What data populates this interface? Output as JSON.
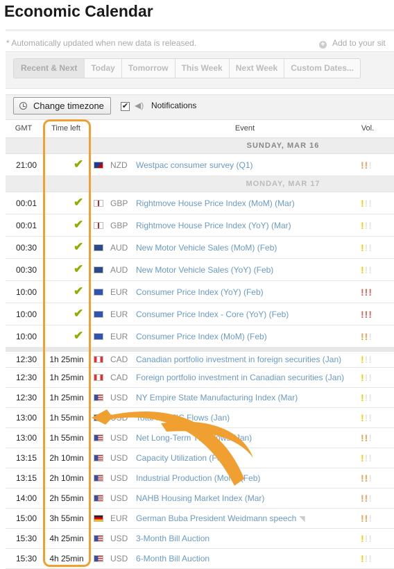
{
  "title": "Economic Calendar",
  "auto_note": "* Automatically updated when new data is released.",
  "add_site": "Add to your sit",
  "tabs": [
    "Recent & Next",
    "Today",
    "Tomorrow",
    "This Week",
    "Next Week",
    "Custom Dates..."
  ],
  "toolbar": {
    "timezone_button": "Change timezone",
    "notifications_label": "Notifications",
    "notifications_checked": true
  },
  "columns": {
    "gmt": "GMT",
    "time_left": "Time left",
    "event": "Event",
    "vol": "Vol."
  },
  "colors": {
    "accent_highlight": "#f0a030",
    "event_link": "#6a9ac8",
    "check_green": "#8cb000"
  },
  "days": [
    {
      "label": "SUNDAY, MAR 16",
      "rows": [
        {
          "gmt": "21:00",
          "done": true,
          "currency": "NZD",
          "flag": "nz-flag-icon",
          "event": "Westpac consumer survey (Q1)",
          "vol": 2
        }
      ]
    },
    {
      "label": "MONDAY, MAR 17",
      "rows": [
        {
          "gmt": "00:01",
          "done": true,
          "currency": "GBP",
          "flag": "gb-flag-icon",
          "event": "Rightmove House Price Index (MoM) (Mar)",
          "vol": 1
        },
        {
          "gmt": "00:01",
          "done": true,
          "currency": "GBP",
          "flag": "gb-flag-icon",
          "event": "Rightmove House Price Index (YoY) (Mar)",
          "vol": 1
        },
        {
          "gmt": "00:30",
          "done": true,
          "currency": "AUD",
          "flag": "au-flag-icon",
          "event": "New Motor Vehicle Sales (MoM) (Feb)",
          "vol": 1
        },
        {
          "gmt": "00:30",
          "done": true,
          "currency": "AUD",
          "flag": "au-flag-icon",
          "event": "New Motor Vehicle Sales (YoY) (Feb)",
          "vol": 1
        },
        {
          "gmt": "10:00",
          "done": true,
          "currency": "EUR",
          "flag": "eu-flag-icon",
          "event": "Consumer Price Index (YoY) (Feb)",
          "vol": 3
        },
        {
          "gmt": "10:00",
          "done": true,
          "currency": "EUR",
          "flag": "eu-flag-icon",
          "event": "Consumer Price Index - Core (YoY) (Feb)",
          "vol": 3
        },
        {
          "gmt": "10:00",
          "done": true,
          "currency": "EUR",
          "flag": "eu-flag-icon",
          "event": "Consumer Price Index (MoM) (Feb)",
          "vol": 2
        },
        {
          "gmt": "12:30",
          "left": "1h 25min",
          "currency": "CAD",
          "flag": "ca-flag-icon",
          "event": "Canadian portfolio investment in foreign securities (Jan)",
          "vol": 1,
          "separator": true
        },
        {
          "gmt": "12:30",
          "left": "1h 25min",
          "currency": "CAD",
          "flag": "ca-flag-icon",
          "event": "Foreign portfolio investment in Canadian securities (Jan)",
          "vol": 1
        },
        {
          "gmt": "12:30",
          "left": "1h 25min",
          "currency": "USD",
          "flag": "us-flag-icon",
          "event": "NY Empire State Manufacturing Index (Mar)",
          "vol": 1
        },
        {
          "gmt": "13:00",
          "left": "1h 55min",
          "currency": "USD",
          "flag": "us-flag-icon",
          "event": "Total Net TIC Flows (Jan)",
          "vol": 1
        },
        {
          "gmt": "13:00",
          "left": "1h 55min",
          "currency": "USD",
          "flag": "us-flag-icon",
          "event": "Net Long-Term TIC Flows (Jan)",
          "vol": 2
        },
        {
          "gmt": "13:15",
          "left": "2h 10min",
          "currency": "USD",
          "flag": "us-flag-icon",
          "event": "Capacity Utilization (Feb)",
          "vol": 1
        },
        {
          "gmt": "13:15",
          "left": "2h 10min",
          "currency": "USD",
          "flag": "us-flag-icon",
          "event": "Industrial Production (MoM) (Feb)",
          "vol": 2
        },
        {
          "gmt": "14:00",
          "left": "2h 55min",
          "currency": "USD",
          "flag": "us-flag-icon",
          "event": "NAHB Housing Market Index (Mar)",
          "vol": 2
        },
        {
          "gmt": "15:00",
          "left": "3h 55min",
          "currency": "EUR",
          "flag": "de-flag-icon",
          "event": "German Buba President Weidmann speech",
          "vol": 2,
          "speech": true
        },
        {
          "gmt": "15:30",
          "left": "4h 25min",
          "currency": "USD",
          "flag": "us-flag-icon",
          "event": "3-Month Bill Auction",
          "vol": 1
        },
        {
          "gmt": "15:30",
          "left": "4h 25min",
          "currency": "USD",
          "flag": "us-flag-icon",
          "event": "6-Month Bill Auction",
          "vol": 1
        }
      ]
    }
  ]
}
